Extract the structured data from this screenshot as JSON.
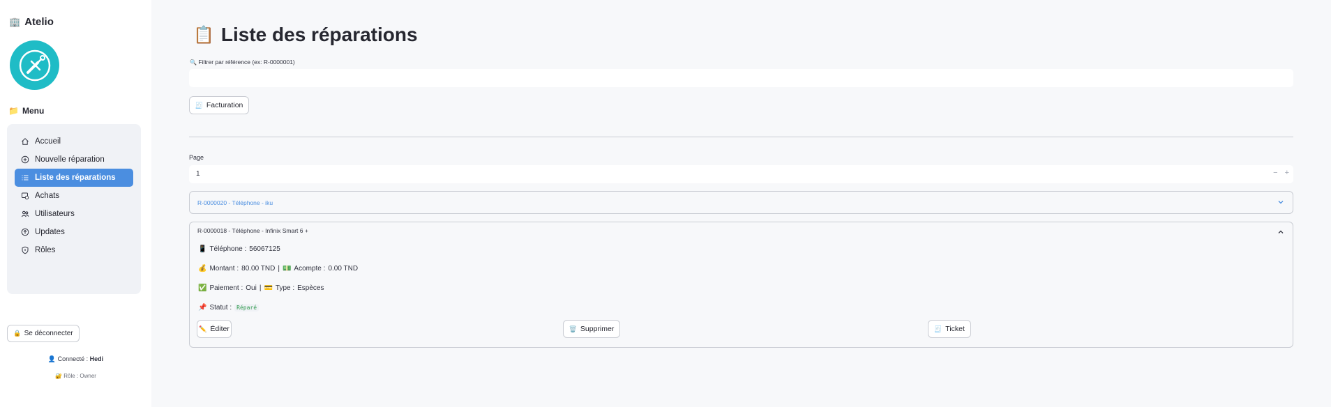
{
  "sidebar": {
    "app_title": "Atelio",
    "menu_title": "Menu",
    "items": [
      {
        "label": "Accueil",
        "icon": "home-icon"
      },
      {
        "label": "Nouvelle réparation",
        "icon": "plus-circle-icon"
      },
      {
        "label": "Liste des réparations",
        "icon": "list-icon",
        "active": true
      },
      {
        "label": "Achats",
        "icon": "purchase-icon"
      },
      {
        "label": "Utilisateurs",
        "icon": "users-icon"
      },
      {
        "label": "Updates",
        "icon": "upload-circle-icon"
      },
      {
        "label": "Rôles",
        "icon": "shield-icon"
      }
    ],
    "logout_label": "Se déconnecter",
    "connected_prefix": "Connecté :",
    "connected_user": "Hedi",
    "role_prefix": "Rôle :",
    "role_value": "Owner"
  },
  "main": {
    "title": "Liste des réparations",
    "filter_label": "Filtrer par référence (ex: R-0000001)",
    "filter_value": "",
    "billing_label": "Facturation",
    "page_label": "Page",
    "page_value": "1",
    "stepper_minus": "−",
    "stepper_plus": "+",
    "repairs": [
      {
        "header": "R-0000020 - Téléphone - iku",
        "expanded": false
      },
      {
        "header": "R-0000018 - Téléphone - Infinix Smart 6 +",
        "expanded": true,
        "phone_label": "Téléphone :",
        "phone": "56067125",
        "amount_label": "Montant :",
        "amount": "80.00 TND",
        "sep": "|",
        "deposit_label": "Acompte :",
        "deposit": "0.00 TND",
        "payment_label": "Paiement :",
        "payment": "Oui",
        "type_label": "Type :",
        "type": "Espèces",
        "status_label": "Statut :",
        "status": "Réparé",
        "edit_label": "Éditer",
        "delete_label": "Supprimer",
        "ticket_label": "Ticket"
      }
    ]
  },
  "colors": {
    "accent": "#4b8ee0",
    "logo": "#1fbcc6",
    "status_green": "#2e9a4c"
  }
}
